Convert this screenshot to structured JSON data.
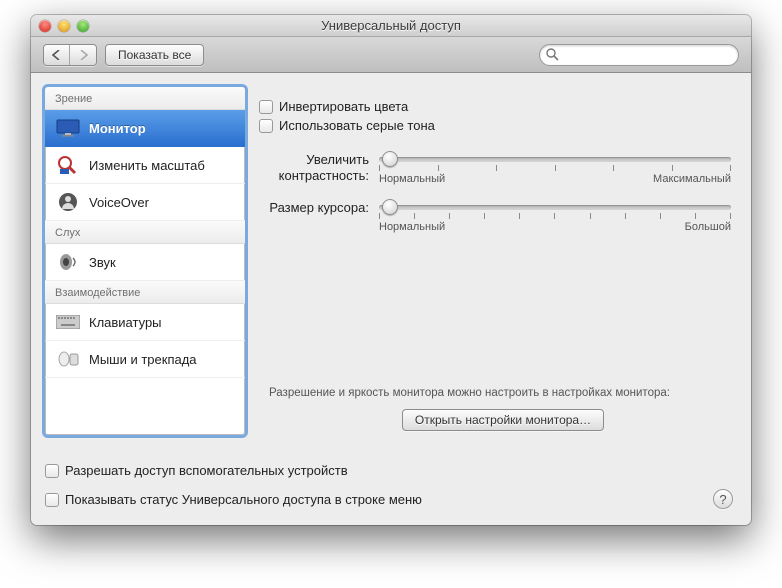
{
  "window": {
    "title": "Универсальный доступ"
  },
  "toolbar": {
    "show_all": "Показать все",
    "search_placeholder": ""
  },
  "sidebar": {
    "groups": [
      {
        "header": "Зрение",
        "items": [
          {
            "label": "Монитор",
            "icon": "monitor-icon",
            "selected": true
          },
          {
            "label": "Изменить масштаб",
            "icon": "zoom-icon"
          },
          {
            "label": "VoiceOver",
            "icon": "voiceover-icon"
          }
        ]
      },
      {
        "header": "Слух",
        "items": [
          {
            "label": "Звук",
            "icon": "speaker-icon"
          }
        ]
      },
      {
        "header": "Взаимодействие",
        "items": [
          {
            "label": "Клавиатуры",
            "icon": "keyboard-icon"
          },
          {
            "label": "Мыши и трекпада",
            "icon": "mouse-icon"
          }
        ]
      }
    ]
  },
  "content": {
    "invert": "Инвертировать цвета",
    "grayscale": "Использовать серые тона",
    "contrast": {
      "label": "Увеличить контрастность:",
      "min_label": "Нормальный",
      "max_label": "Максимальный",
      "value_percent": 0
    },
    "cursor": {
      "label": "Размер курсора:",
      "min_label": "Нормальный",
      "max_label": "Большой",
      "value_percent": 0
    },
    "hint": "Разрешение и яркость монитора можно настроить в настройках монитора:",
    "open_display": "Открыть настройки монитора…"
  },
  "footer": {
    "assistive": "Разрешать доступ вспомогательных устройств",
    "menu_status": "Показывать статус Универсального доступа в строке меню"
  }
}
